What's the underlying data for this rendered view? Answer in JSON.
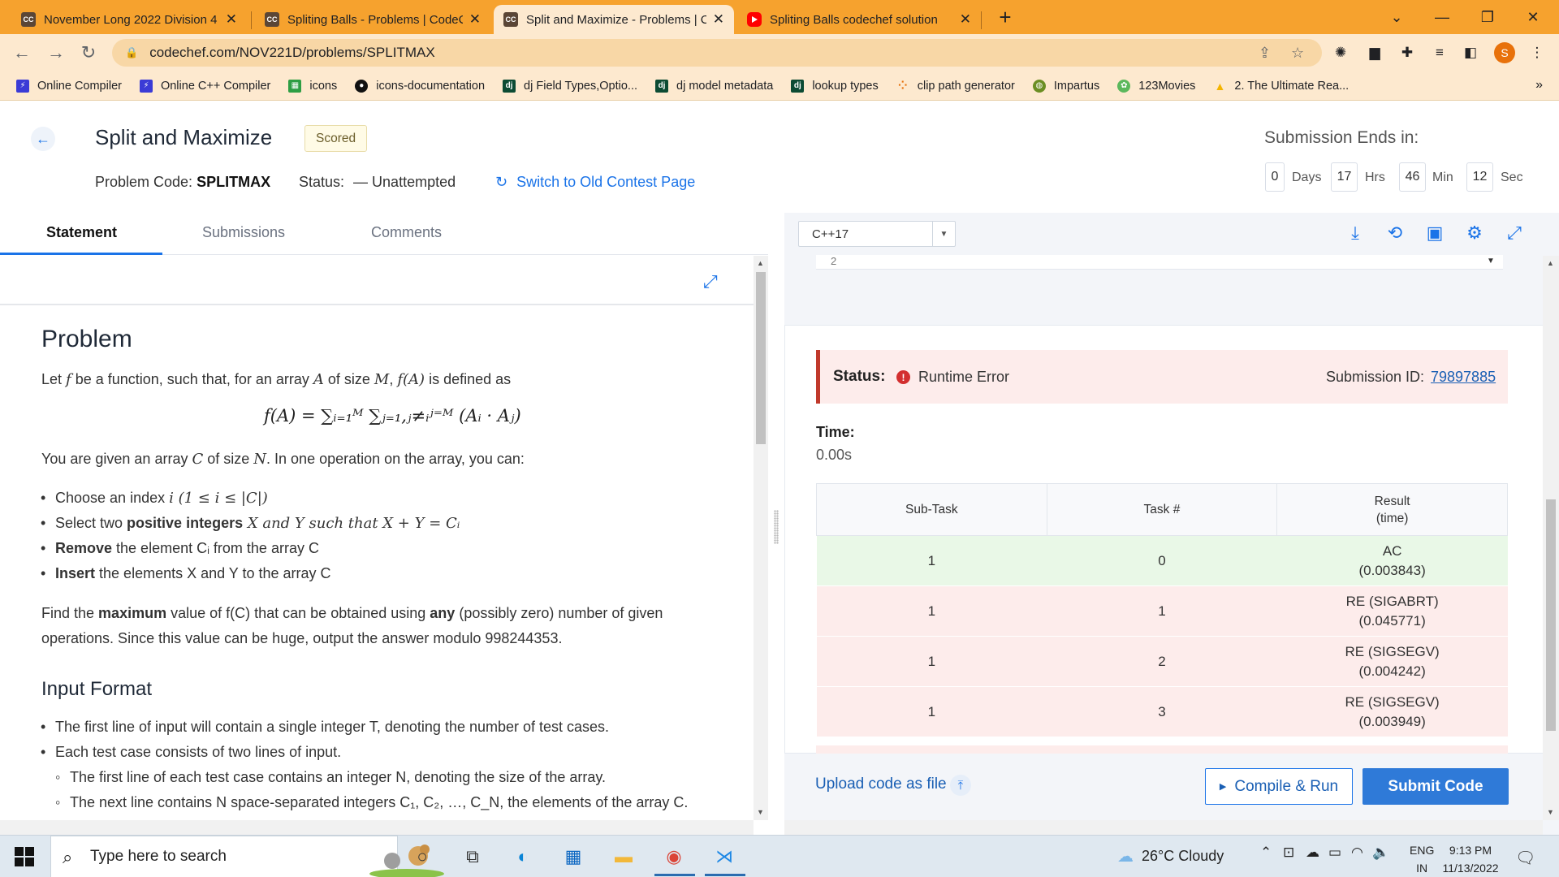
{
  "browser": {
    "tabs": [
      {
        "label": "November Long 2022 Division 4",
        "favicon": "CC"
      },
      {
        "label": "Spliting Balls - Problems | CodeC",
        "favicon": "CC"
      },
      {
        "label": "Split and Maximize - Problems | C",
        "favicon": "CC",
        "active": true
      },
      {
        "label": "Spliting Balls codechef solution",
        "favicon": "youtube-icon"
      }
    ],
    "url": "codechef.com/NOV221D/problems/SPLITMAX",
    "profile_initial": "S",
    "bookmarks": [
      {
        "label": "Online Compiler",
        "icon": "bolt-icon",
        "color": "#3b3bd6"
      },
      {
        "label": "Online C++ Compiler",
        "icon": "bolt-icon",
        "color": "#3b3bd6"
      },
      {
        "label": "icons",
        "icon": "grid-icon",
        "color": "#2e9e44"
      },
      {
        "label": "icons-documentation",
        "icon": "github-icon",
        "color": "#111111"
      },
      {
        "label": "dj Field Types,Optio...",
        "icon": "dj",
        "color": "#0c4b33"
      },
      {
        "label": "dj model metadata",
        "icon": "dj",
        "color": "#0c4b33"
      },
      {
        "label": "lookup types",
        "icon": "dj",
        "color": "#0c4b33"
      },
      {
        "label": "clip path generator",
        "icon": "dots-icon",
        "color": "#e8710a"
      },
      {
        "label": "Impartus",
        "icon": "globe-icon",
        "color": "#6b8e23"
      },
      {
        "label": "123Movies",
        "icon": "film-icon",
        "color": "#5cb85c"
      },
      {
        "label": "2. The Ultimate Rea...",
        "icon": "drive-icon",
        "color": "#f4b400"
      }
    ]
  },
  "header": {
    "title": "Split and Maximize",
    "badge": "Scored",
    "problem_code_label": "Problem Code:",
    "problem_code": "SPLITMAX",
    "status_label": "Status:",
    "status_value": "— Unattempted",
    "old_page_link": "Switch to Old Contest Page",
    "submission_ends_label": "Submission Ends in:",
    "countdown": [
      {
        "value": "0",
        "unit": "Days"
      },
      {
        "value": "17",
        "unit": "Hrs"
      },
      {
        "value": "46",
        "unit": "Min"
      },
      {
        "value": "12",
        "unit": "Sec"
      }
    ]
  },
  "left_tabs": [
    "Statement",
    "Submissions",
    "Comments"
  ],
  "statement": {
    "problem_heading": "Problem",
    "intro_pre": "Let ",
    "intro_f": "f",
    "intro_mid": " be a function, such that, for an array ",
    "intro_A": "A",
    "intro_mid2": " of size ",
    "intro_M": "M",
    "intro_comma": ", ",
    "intro_fA": "f(A)",
    "intro_post": " is defined as",
    "formula": "f(A) = ∑ᵢ₌₁ᴹ ∑ⱼ₌₁,ⱼ≠ᵢʲ⁼ᴹ (Aᵢ · Aⱼ)",
    "given_pre": "You are given an array ",
    "given_C": "C",
    "given_mid": " of size ",
    "given_N": "N",
    "given_post": ". In one operation on the array, you can:",
    "ops": [
      {
        "pre": "Choose an index ",
        "bold": "",
        "math": "i (1 ≤ i ≤ |C|)",
        "post": ""
      },
      {
        "pre": "Select two ",
        "bold": "positive integers",
        "math": " X and Y ",
        "post": "such that X + Y = Cᵢ"
      },
      {
        "pre": "",
        "bold": "Remove",
        "math": "",
        "post": " the element Cᵢ from the array C"
      },
      {
        "pre": "",
        "bold": "Insert",
        "math": "",
        "post": " the elements X and Y to the array C"
      }
    ],
    "find_line1_pre": "Find the ",
    "find_line1_bold1": "maximum",
    "find_line1_mid": " value of f(C) that can be obtained using ",
    "find_line1_bold2": "any",
    "find_line1_post": " (possibly zero) number of given",
    "find_line2": "operations. Since this value can be huge, output the answer modulo 998244353.",
    "input_heading": "Input Format",
    "input_items": [
      {
        "text": "The first line of input will contain a single integer T, denoting the number of test cases.",
        "sub": false
      },
      {
        "text": "Each test case consists of two lines of input.",
        "sub": false
      },
      {
        "text": "The first line of each test case contains an integer N, denoting the size of the array.",
        "sub": true
      },
      {
        "text": "The next line contains N space-separated integers C₁, C₂, …, C_N, the elements of the array C.",
        "sub": true
      }
    ]
  },
  "editor": {
    "language": "C++17",
    "visible_input": "2"
  },
  "result": {
    "status_label": "Status:",
    "status_value": "Runtime Error",
    "submission_id_label": "Submission ID:",
    "submission_id": "79897885",
    "time_label": "Time:",
    "time_value": "0.00s",
    "columns": [
      "Sub-Task",
      "Task #",
      "Result\n(time)"
    ],
    "rows": [
      {
        "subtask": "1",
        "task": "0",
        "result": "AC",
        "time": "(0.003843)",
        "state": "ac"
      },
      {
        "subtask": "1",
        "task": "1",
        "result": "RE (SIGABRT)",
        "time": "(0.045771)",
        "state": "re"
      },
      {
        "subtask": "1",
        "task": "2",
        "result": "RE (SIGSEGV)",
        "time": "(0.004242)",
        "state": "re"
      },
      {
        "subtask": "1",
        "task": "3",
        "result": "RE (SIGSEGV)",
        "time": "(0.003949)",
        "state": "re"
      }
    ],
    "upload_label": "Upload code as file",
    "compile_label": "Compile & Run",
    "submit_label": "Submit Code"
  },
  "taskbar": {
    "search_placeholder": "Type here to search",
    "weather": "26°C  Cloudy",
    "lang_line1": "ENG",
    "lang_line2": "IN",
    "time": "9:13 PM",
    "date": "11/13/2022"
  },
  "colors": {
    "tab_strip": "#f6a22e",
    "accent": "#1a73e8",
    "error": "#d32f2f",
    "ac_row": "#e9f8e7",
    "re_row": "#fdeceb"
  }
}
